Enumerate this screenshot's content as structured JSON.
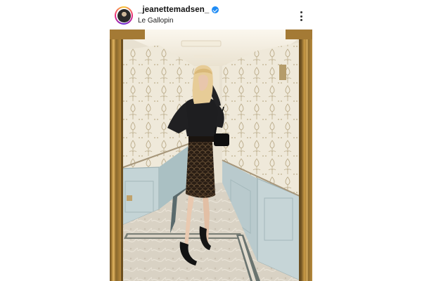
{
  "post": {
    "username": "_jeanettemadsen_",
    "location": "Le Gallopin",
    "avatar_icon": "profile-avatar",
    "verified_icon": "verified-badge-icon",
    "more_icon": "more-vertical-icon",
    "verified_color": "#1f8cf5"
  },
  "photo": {
    "icon": "mirror-selfie-photo"
  }
}
